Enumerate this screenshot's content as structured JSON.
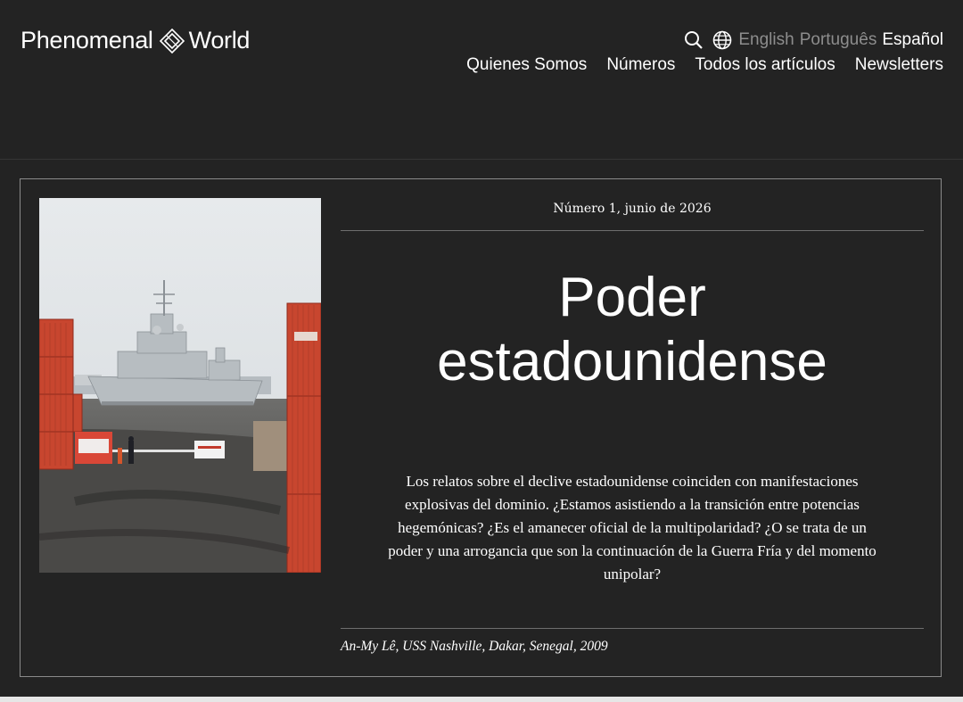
{
  "site": {
    "brand_left": "Phenomenal",
    "brand_right": "World"
  },
  "header": {
    "search_icon": "search-icon",
    "globe_icon": "globe-icon",
    "languages": [
      {
        "label": "English",
        "active": false
      },
      {
        "label": "Português",
        "active": false
      },
      {
        "label": "Español",
        "active": true
      }
    ],
    "nav": [
      "Quienes Somos",
      "Números",
      "Todos los artículos",
      "Newsletters"
    ]
  },
  "feature": {
    "issue": "Número 1, junio de 2026",
    "title_line1": "Poder",
    "title_line2": "estadounidense",
    "summary": "Los relatos sobre el declive estadounidense coinciden con manifestaciones explosivas del dominio. ¿Estamos asistiendo a la transición entre potencias hegemónicas? ¿Es el amanecer oficial de la multipolaridad? ¿O se trata de un poder y una arrogancia que son la continuación de la Guerra Fría y del momento unipolar?",
    "caption": "An-My Lê, USS Nashville, Dakar, Senegal, 2009"
  },
  "colors": {
    "background": "#232323",
    "text": "#ffffff",
    "inactive_language": "#8d8d8d",
    "border": "#8a8a8a"
  }
}
